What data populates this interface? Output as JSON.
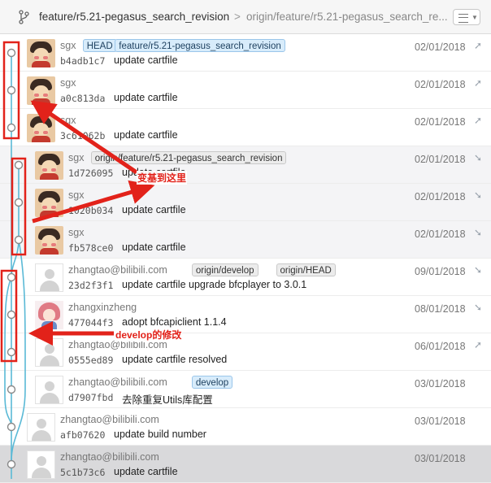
{
  "header": {
    "current_branch": "feature/r5.21-pegasus_search_revision",
    "separator": ">",
    "upstream_branch": "origin/feature/r5.21-pegasus_search_re..."
  },
  "commits": [
    {
      "author": "sgx",
      "avatar": "anime",
      "hash": "b4adb1c7",
      "message": "update cartfile",
      "date": "02/01/2018",
      "tags": [
        {
          "text": "HEAD",
          "style": "blue"
        },
        {
          "text": "feature/r5.21-pegasus_search_revision",
          "style": "blue"
        }
      ],
      "direction": "up-right-arrow-icon",
      "shade": "none"
    },
    {
      "author": "sgx",
      "avatar": "anime",
      "hash": "a0c813da",
      "message": "update cartfile",
      "date": "02/01/2018",
      "tags": [],
      "direction": "up-right-arrow-icon",
      "shade": "none"
    },
    {
      "author": "sgx",
      "avatar": "anime",
      "hash": "3c61062b",
      "message": "update cartfile",
      "date": "02/01/2018",
      "tags": [],
      "direction": "up-right-arrow-icon",
      "shade": "none"
    },
    {
      "author": "sgx",
      "avatar": "anime",
      "hash": "1d726095",
      "message": "update cartfile",
      "date": "02/01/2018",
      "tags": [
        {
          "text": "origin/feature/r5.21-pegasus_search_revision",
          "style": "gray"
        }
      ],
      "direction": "down-left-arrow-icon",
      "shade": "alt"
    },
    {
      "author": "sgx",
      "avatar": "anime",
      "hash": "1020b034",
      "message": "update cartfile",
      "date": "02/01/2018",
      "tags": [],
      "direction": "down-left-arrow-icon",
      "shade": "alt"
    },
    {
      "author": "sgx",
      "avatar": "anime",
      "hash": "fb578ce0",
      "message": "update cartfile",
      "date": "02/01/2018",
      "tags": [],
      "direction": "down-left-arrow-icon",
      "shade": "alt"
    },
    {
      "author": "zhangtao@bilibili.com",
      "avatar": "blank",
      "hash": "23d2f3f1",
      "message": "update cartfile upgrade bfcplayer to 3.0.1",
      "date": "09/01/2018",
      "tags": [
        {
          "text": "origin/develop",
          "style": "gray"
        },
        {
          "text": "origin/HEAD",
          "style": "gray"
        }
      ],
      "direction": "down-left-arrow-icon",
      "shade": "none"
    },
    {
      "author": "zhangxinzheng",
      "avatar": "girl",
      "hash": "477044f3",
      "message": "adopt bfcapiclient 1.1.4",
      "date": "08/01/2018",
      "tags": [],
      "direction": "down-left-arrow-icon",
      "shade": "none"
    },
    {
      "author": "zhangtao@bilibili.com",
      "avatar": "blank",
      "hash": "0555ed89",
      "message": "update cartfile resolved",
      "date": "06/01/2018",
      "tags": [],
      "direction": "up-right-arrow-icon",
      "shade": "none"
    },
    {
      "author": "zhangtao@bilibili.com",
      "avatar": "blank",
      "hash": "d7907fbd",
      "message": "去除重复Utils库配置",
      "date": "03/01/2018",
      "tags": [
        {
          "text": "develop",
          "style": "blue"
        }
      ],
      "direction": "",
      "shade": "none"
    },
    {
      "author": "zhangtao@bilibili.com",
      "avatar": "blank",
      "hash": "afb07620",
      "message": "update build number",
      "date": "03/01/2018",
      "tags": [],
      "direction": "",
      "shade": "none"
    },
    {
      "author": "zhangtao@bilibili.com",
      "avatar": "blank",
      "hash": "5c1b73c6",
      "message": "update cartfile",
      "date": "03/01/2018",
      "tags": [],
      "direction": "",
      "shade": "selected"
    }
  ],
  "annotations": {
    "rebase_label": "变基到这里",
    "develop_label": "develop的修改",
    "accent_color": "#e2221a",
    "graph_color": "#5ab9d6"
  }
}
